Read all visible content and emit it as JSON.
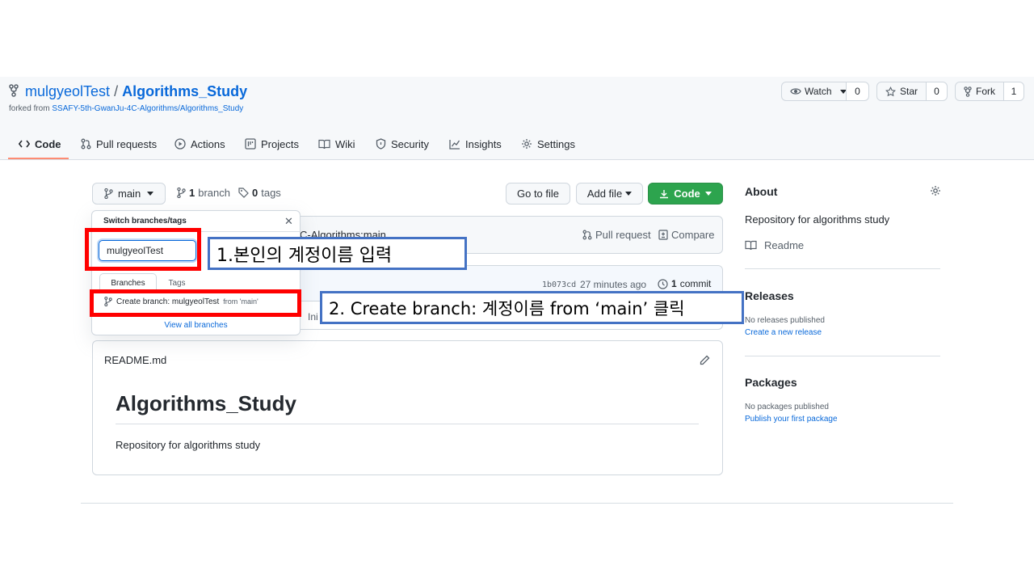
{
  "repo": {
    "owner": "mulgyeolTest",
    "separator": "/",
    "name": "Algorithms_Study",
    "forked_prefix": "forked from",
    "forked_from": "SSAFY-5th-GwanJu-4C-Algorithms/Algorithms_Study"
  },
  "actions": {
    "watch_label": "Watch",
    "watch_count": "0",
    "star_label": "Star",
    "star_count": "0",
    "fork_label": "Fork",
    "fork_count": "1"
  },
  "tabs": [
    {
      "label": "Code",
      "icon": "code-icon"
    },
    {
      "label": "Pull requests",
      "icon": "pull-request-icon"
    },
    {
      "label": "Actions",
      "icon": "play-icon"
    },
    {
      "label": "Projects",
      "icon": "project-icon"
    },
    {
      "label": "Wiki",
      "icon": "book-icon"
    },
    {
      "label": "Security",
      "icon": "shield-icon"
    },
    {
      "label": "Insights",
      "icon": "graph-icon"
    },
    {
      "label": "Settings",
      "icon": "gear-icon"
    }
  ],
  "toolbar": {
    "branch": "main",
    "branch_count": "1",
    "branch_word": "branch",
    "tag_count": "0",
    "tag_word": "tags",
    "go_to_file": "Go to file",
    "add_file": "Add file",
    "code": "Code"
  },
  "dropdown": {
    "title": "Switch branches/tags",
    "input_value": "mulgyeolTest",
    "tab_branches": "Branches",
    "tab_tags": "Tags",
    "create_label": "Create branch: mulgyeolTest",
    "create_from": "from 'main'",
    "view_all": "View all branches"
  },
  "compare_bar": {
    "text": "C-Algorithms:main",
    "pull_request": "Pull request",
    "compare": "Compare"
  },
  "commit_bar": {
    "hash": "1b073cd",
    "time": "27 minutes ago",
    "commit_count": "1",
    "commit_word": "commit",
    "row_text": "Ini"
  },
  "readme": {
    "filename": "README.md",
    "heading": "Algorithms_Study",
    "body": "Repository for algorithms study"
  },
  "about": {
    "title": "About",
    "description": "Repository for algorithms study",
    "readme_link": "Readme"
  },
  "releases": {
    "title": "Releases",
    "none": "No releases published",
    "create": "Create a new release"
  },
  "packages": {
    "title": "Packages",
    "none": "No packages published",
    "publish": "Publish your first package"
  },
  "annotations": {
    "step1": "1.본인의 계정이름 입력",
    "step2": "2. Create branch: 계정이름 from ‘main’ 클릭"
  },
  "colors": {
    "accent_blue": "#0969da",
    "code_button": "#2da44e",
    "tab_underline": "#fd8c73",
    "annotation_red": "#ff0000",
    "annotation_blue": "#4472c4"
  }
}
